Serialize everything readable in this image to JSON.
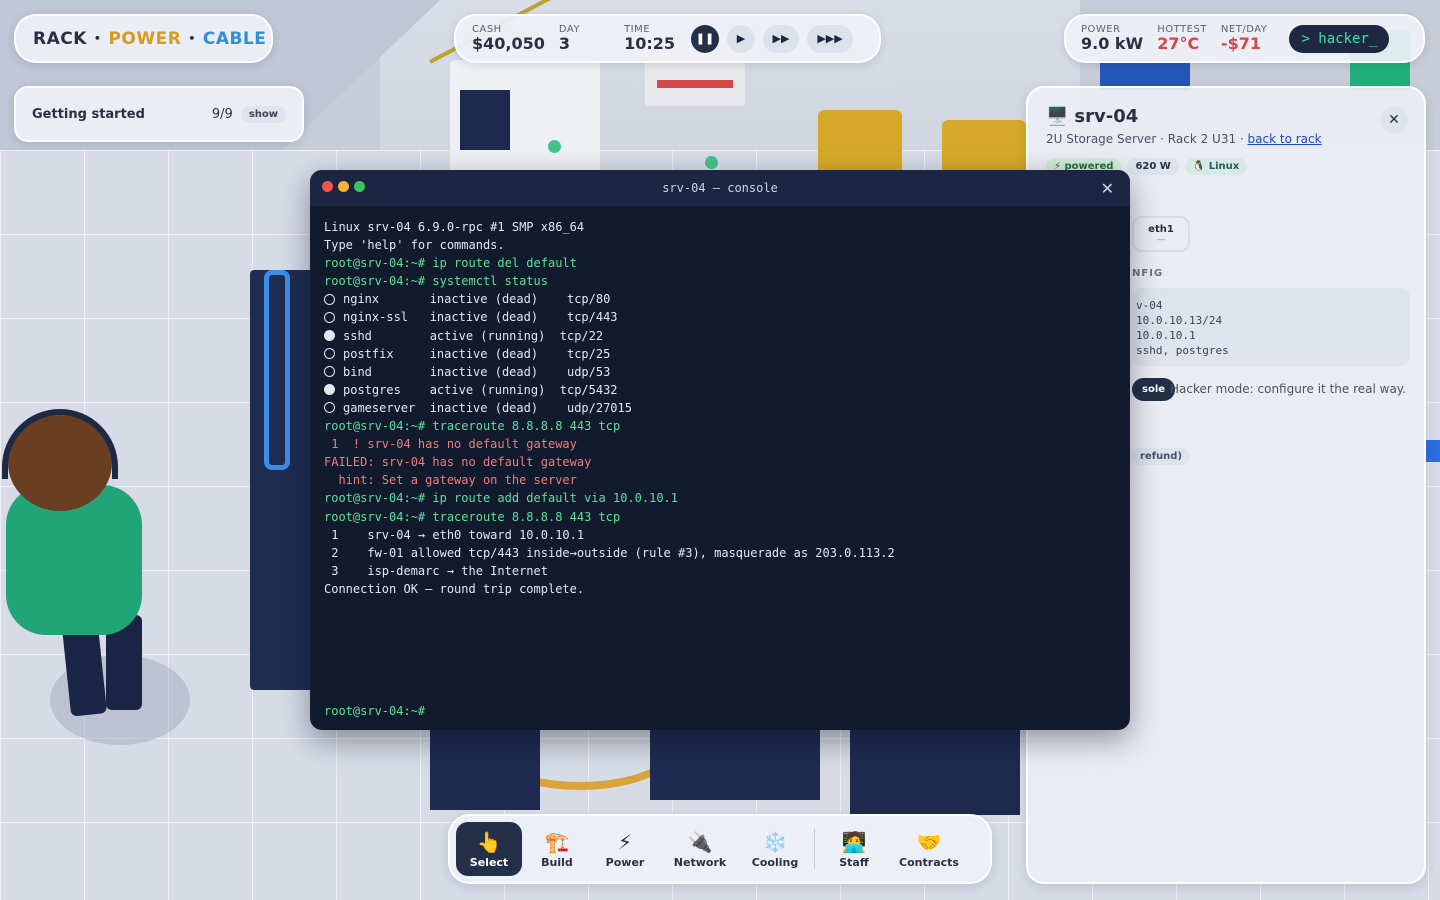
{
  "brand": {
    "rack": "RACK",
    "power": "POWER",
    "cable": "CABLE",
    "sep": "•"
  },
  "getting_started": {
    "label": "Getting started",
    "count": "9/9",
    "show": "show"
  },
  "clock": {
    "cash_label": "CASH",
    "cash": "$40,050",
    "day_label": "DAY",
    "day": "3",
    "time_label": "TIME",
    "time": "10:25",
    "speed_buttons": [
      {
        "name": "pause",
        "glyph": "❚❚"
      },
      {
        "name": "play",
        "glyph": "▶"
      },
      {
        "name": "fast",
        "glyph": "▶▶"
      },
      {
        "name": "fastest",
        "glyph": "▶▶▶"
      }
    ]
  },
  "power": {
    "power_label": "POWER",
    "power": "9.0 kW",
    "hottest_label": "HOTTEST",
    "hottest": "27°C",
    "net_label": "NET/DAY",
    "net": "-$71",
    "hacker": "> hacker_"
  },
  "inspector": {
    "title": "srv-04",
    "icon": "server-icon",
    "subtitle": "2U Storage Server · Rack 2 U31 · ",
    "back_link": "back to rack",
    "badges": {
      "powered": "⚡ powered",
      "watts": "620 W",
      "os": "🐧 Linux"
    },
    "iface_name": "eth1",
    "iface_state": "—",
    "config_label": "NFIG",
    "config_lines": [
      "v-04",
      "10.0.10.13/24",
      "10.0.10.1",
      "sshd, postgres"
    ],
    "console_button": "sole",
    "hint": "Hacker mode: configure it the real way.",
    "refund": "refund)"
  },
  "terminal": {
    "title": "srv-04 — console",
    "lines": [
      {
        "text": "Linux srv-04 6.9.0-rpc #1 SMP x86_64",
        "color": "white"
      },
      {
        "text": "Type 'help' for commands.",
        "color": "white"
      },
      {
        "text": "root@srv-04:~# ip route del default",
        "color": "green"
      },
      {
        "text": "root@srv-04:~# systemctl status",
        "color": "green"
      }
    ],
    "services": [
      {
        "name": "nginx",
        "state": "inactive (dead)",
        "port": "tcp/80",
        "active": false
      },
      {
        "name": "nginx-ssl",
        "state": "inactive (dead)",
        "port": "tcp/443",
        "active": false
      },
      {
        "name": "sshd",
        "state": "active (running)",
        "port": "tcp/22",
        "active": true
      },
      {
        "name": "postfix",
        "state": "inactive (dead)",
        "port": "tcp/25",
        "active": false
      },
      {
        "name": "bind",
        "state": "inactive (dead)",
        "port": "udp/53",
        "active": false
      },
      {
        "name": "postgres",
        "state": "active (running)",
        "port": "tcp/5432",
        "active": true
      },
      {
        "name": "gameserver",
        "state": "inactive (dead)",
        "port": "udp/27015",
        "active": false
      }
    ],
    "after": [
      {
        "text": "root@srv-04:~# traceroute 8.8.8.8 443 tcp",
        "color": "green"
      },
      {
        "text": " 1  ! srv-04 has no default gateway",
        "color": "red"
      },
      {
        "text": "FAILED: srv-04 has no default gateway",
        "color": "red"
      },
      {
        "text": "  hint: Set a gateway on the server",
        "color": "red"
      },
      {
        "text": "root@srv-04:~# ip route add default via 10.0.10.1",
        "color": "green"
      },
      {
        "text": "root@srv-04:~# traceroute 8.8.8.8 443 tcp",
        "color": "green"
      },
      {
        "text": " 1    srv-04 → eth0 toward 10.0.10.1",
        "color": "white"
      },
      {
        "text": " 2    fw-01 allowed tcp/443 inside→outside (rule #3), masquerade as 203.0.113.2",
        "color": "white"
      },
      {
        "text": " 3    isp-demarc → the Internet",
        "color": "white"
      },
      {
        "text": "Connection OK — round trip complete.",
        "color": "white"
      }
    ],
    "prompt": "root@srv-04:~#"
  },
  "toolbar": [
    {
      "name": "select",
      "label": "Select",
      "icon": "👆",
      "active": true
    },
    {
      "name": "build",
      "label": "Build",
      "icon": "🏗️",
      "active": false
    },
    {
      "name": "power",
      "label": "Power",
      "icon": "⚡",
      "active": false
    },
    {
      "name": "network",
      "label": "Network",
      "icon": "🔌",
      "active": false
    },
    {
      "name": "cooling",
      "label": "Cooling",
      "icon": "❄️",
      "active": false
    },
    {
      "name": "staff",
      "label": "Staff",
      "icon": "🧑‍💻",
      "active": false
    },
    {
      "name": "contracts",
      "label": "Contracts",
      "icon": "🤝",
      "active": false
    }
  ],
  "colors": {
    "brand_power": "#d79a1c",
    "brand_cable": "#2f8fd8",
    "danger": "#d9434b",
    "term_green": "#5fe09a",
    "term_red": "#f07c7c",
    "terminal_bg": "#121a2e"
  }
}
